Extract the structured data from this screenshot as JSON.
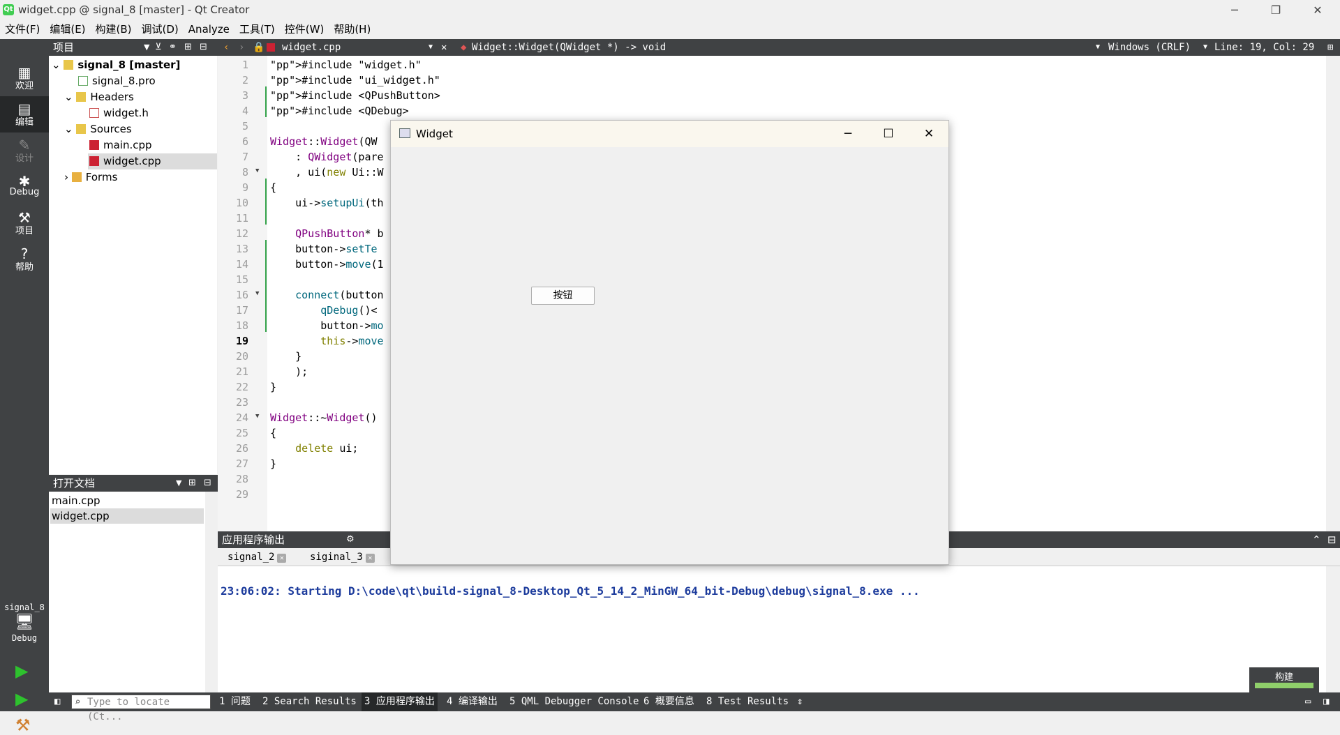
{
  "window": {
    "title": "widget.cpp @ signal_8 [master] - Qt Creator",
    "icon": "qt-logo-icon"
  },
  "menu": [
    "文件(F)",
    "编辑(E)",
    "构建(B)",
    "调试(D)",
    "Analyze",
    "工具(T)",
    "控件(W)",
    "帮助(H)"
  ],
  "modes": [
    {
      "label": "欢迎",
      "icon": "grid-icon"
    },
    {
      "label": "编辑",
      "icon": "edit-icon"
    },
    {
      "label": "设计",
      "icon": "pencil-icon"
    },
    {
      "label": "Debug",
      "icon": "bug-icon"
    },
    {
      "label": "项目",
      "icon": "wrench-icon"
    },
    {
      "label": "帮助",
      "icon": "help-icon"
    }
  ],
  "kit": {
    "project": "signal_8",
    "config": "Debug"
  },
  "projects": {
    "header": "项目",
    "tree": [
      {
        "label": "signal_8 [master]"
      },
      {
        "label": "signal_8.pro"
      },
      {
        "label": "Headers"
      },
      {
        "label": "widget.h"
      },
      {
        "label": "Sources"
      },
      {
        "label": "main.cpp"
      },
      {
        "label": "widget.cpp"
      },
      {
        "label": "Forms"
      }
    ]
  },
  "open_docs": {
    "header": "打开文档",
    "items": [
      "main.cpp",
      "widget.cpp"
    ]
  },
  "editor": {
    "file": "widget.cpp",
    "symbol": "Widget::Widget(QWidget *) -> void",
    "encoding": "Windows (CRLF)",
    "position": "Line: 19, Col: 29",
    "line_numbers": [
      "1",
      "2",
      "3",
      "4",
      "5",
      "6",
      "7",
      "8",
      "9",
      "10",
      "11",
      "12",
      "13",
      "14",
      "15",
      "16",
      "17",
      "18",
      "19",
      "20",
      "21",
      "22",
      "23",
      "24",
      "25",
      "26",
      "27",
      "28",
      "29"
    ],
    "lines": [
      "#include \"widget.h\"",
      "#include \"ui_widget.h\"",
      "#include <QPushButton>",
      "#include <QDebug>",
      "",
      "Widget::Widget(QW",
      "    : QWidget(pare",
      "    , ui(new Ui::W",
      "{",
      "    ui->setupUi(th",
      "",
      "    QPushButton* b",
      "    button->setTe",
      "    button->move(1",
      "",
      "    connect(button",
      "        qDebug()<",
      "        button->mo",
      "        this->move",
      "    }",
      "    );",
      "}",
      "",
      "Widget::~Widget()",
      "{",
      "    delete ui;",
      "}",
      "",
      ""
    ]
  },
  "widget_window": {
    "title": "Widget",
    "button": "按钮"
  },
  "output": {
    "header": "应用程序输出",
    "tabs": [
      "signal_2",
      "siginal_3"
    ],
    "text": "23:06:02: Starting D:\\code\\qt\\build-signal_8-Desktop_Qt_5_14_2_MinGW_64_bit-Debug\\debug\\signal_8.exe ..."
  },
  "statusbar": {
    "locate_placeholder": "Type to locate (Ct...",
    "panes": [
      "1 问题",
      "2 Search Results",
      "3 应用程序输出",
      "4 编译输出",
      "5 QML Debugger Console",
      "6 概要信息",
      "8 Test Results"
    ]
  },
  "build_progress": {
    "label": "构建",
    "fraction": 1.0
  },
  "colors": {
    "sidebar": "#404244",
    "output_text": "#1c3b9c",
    "progress": "#8fcf6a"
  }
}
